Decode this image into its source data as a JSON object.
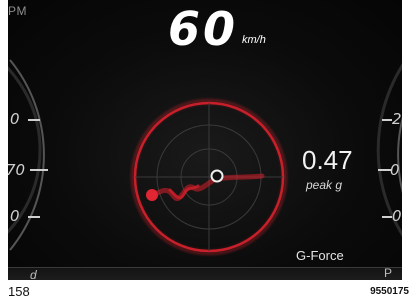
{
  "clock": {
    "text": "PM"
  },
  "speed": {
    "value": "60",
    "unit": "km/h"
  },
  "left_gauge": {
    "labels": [
      "0",
      "70",
      "0",
      "d"
    ]
  },
  "right_gauge": {
    "labels": [
      "2",
      "0",
      "0",
      "P"
    ]
  },
  "gforce": {
    "title": "G-Force",
    "peak_value": "0.47",
    "peak_label": "peak g",
    "accent_color": "#c8202a",
    "trace_color": "#d61f2a"
  },
  "footer": {
    "page_number": "158",
    "reference_code": "9550175"
  }
}
